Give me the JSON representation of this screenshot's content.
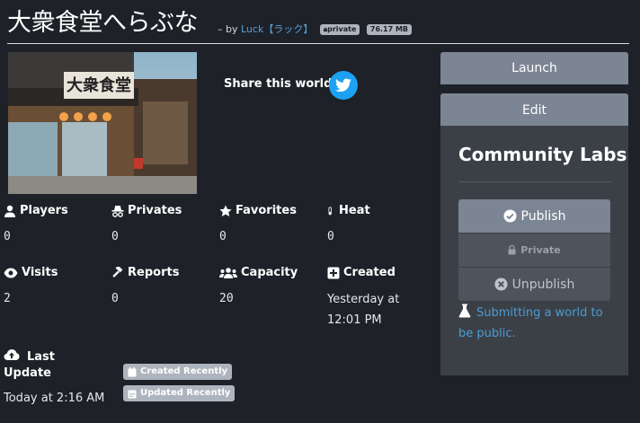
{
  "header": {
    "title": "大衆食堂へらぶな",
    "by_prefix": "– by",
    "author": "Luck【ラック】",
    "badge_private": "private",
    "badge_size": "76.17 MB"
  },
  "share": {
    "label": "Share this world",
    "icon": "twitter-icon"
  },
  "stats": {
    "players": {
      "label": "Players",
      "value": "0",
      "icon": "user-icon"
    },
    "privates": {
      "label": "Privates",
      "value": "0",
      "icon": "incognito-icon"
    },
    "favorites": {
      "label": "Favorites",
      "value": "0",
      "icon": "star-icon"
    },
    "heat": {
      "label": "Heat",
      "value": "0",
      "icon": "thermometer-icon"
    },
    "visits": {
      "label": "Visits",
      "value": "2",
      "icon": "eye-icon"
    },
    "reports": {
      "label": "Reports",
      "value": "0",
      "icon": "gavel-icon"
    },
    "capacity": {
      "label": "Capacity",
      "value": "20",
      "icon": "users-icon"
    },
    "created": {
      "label": "Created",
      "value": "Yesterday at 12:01 PM",
      "icon": "plus-square-icon"
    }
  },
  "last_update": {
    "label": "Last Update",
    "value": "Today at 2:16 AM",
    "icon": "cloud-upload-icon",
    "pill_created": "Created Recently",
    "pill_updated": "Updated Recently"
  },
  "actions": {
    "launch": "Launch",
    "edit": "Edit"
  },
  "community_labs": {
    "title": "Community Labs",
    "publish": "Publish",
    "private": "Private",
    "unpublish": "Unpublish",
    "link": "Submitting a world to be public."
  },
  "colors": {
    "background": "#1e2128",
    "panel": "#3b4047",
    "button": "#7b8593",
    "link": "#4d9bd2",
    "twitter": "#1da1f2",
    "badge": "#aeb4be"
  }
}
